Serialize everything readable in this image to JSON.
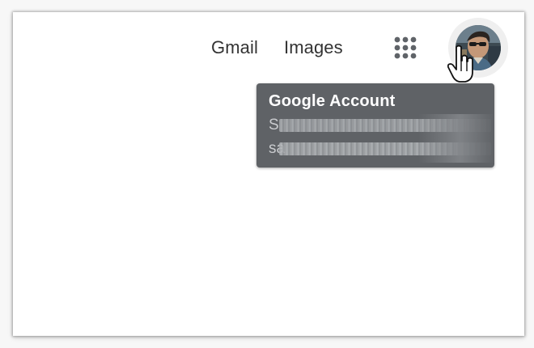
{
  "header": {
    "links": [
      {
        "label": "Gmail"
      },
      {
        "label": "Images"
      }
    ],
    "apps_icon": "apps-grid-icon",
    "avatar_icon": "user-avatar"
  },
  "tooltip": {
    "title": "Google Account",
    "name_visible_prefix": "S",
    "email_visible_prefix": "sa"
  },
  "colors": {
    "link_text": "#333333",
    "apps_dots": "#5f6368",
    "tooltip_bg": "#5f6266",
    "tooltip_title": "#ffffff"
  },
  "cursor": "hand-pointer-icon"
}
